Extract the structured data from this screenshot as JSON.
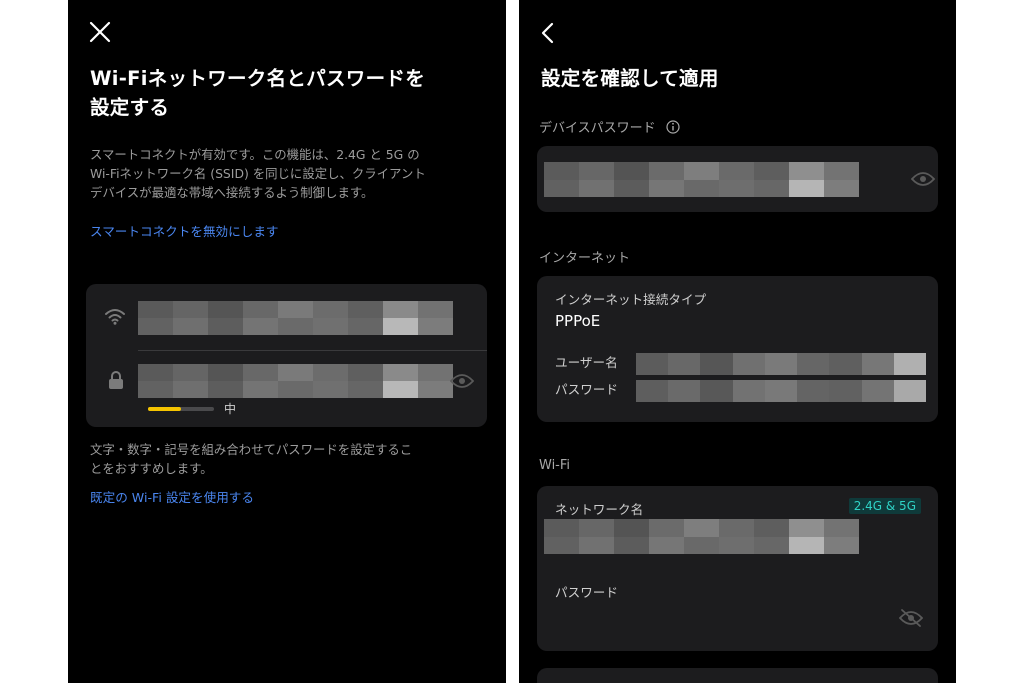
{
  "left": {
    "title_line1": "Wi-Fiネットワーク名とパスワードを",
    "title_line2": "設定する",
    "desc_line1": "スマートコネクトが有効です。この機能は、2.4G と 5G の",
    "desc_line2": "Wi-Fiネットワーク名 (SSID) を同じに設定し、クライアント",
    "desc_line3": "デバイスが最適な帯域へ接続するよう制御します。",
    "disable_link": "スマートコネクトを無効にします",
    "strength_label": "中",
    "strength_level": 0.5,
    "strength_color": "#f5c400",
    "hint_line1": "文字・数字・記号を組み合わせてパスワードを設定するこ",
    "hint_line2": "とをおすすめします。",
    "default_link": "既定の Wi-Fi 設定を使用する"
  },
  "right": {
    "title": "設定を確認して適用",
    "device_password_label": "デバイスパスワード",
    "internet_label": "インターネット",
    "connection_type_label": "インターネット接続タイプ",
    "connection_type_value": "PPPoE",
    "username_label": "ユーザー名",
    "password_label": "パスワード",
    "wifi_label": "Wi-Fi",
    "network_name_label": "ネットワーク名",
    "band_tag": "2.4G & 5G",
    "wifi_password_label": "パスワード"
  },
  "colors": {
    "accent_link": "#4a86f0",
    "tag_text": "#2fd3c6",
    "card_bg": "#1c1c1e"
  },
  "icons": [
    "close-icon",
    "back-chevron-icon",
    "wifi-icon",
    "lock-icon",
    "eye-icon",
    "info-icon",
    "eye-off-icon"
  ]
}
